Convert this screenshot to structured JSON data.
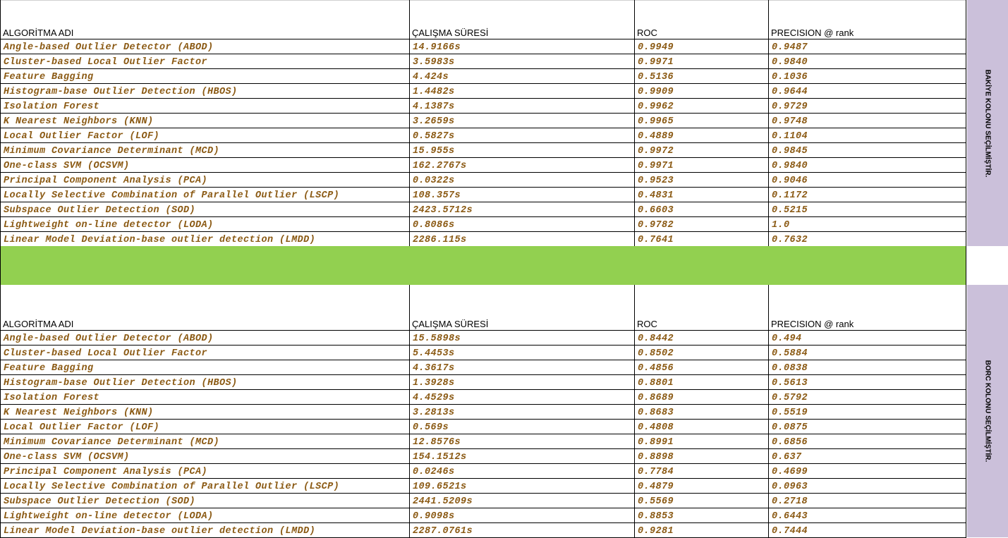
{
  "headers": {
    "algorithm": "ALGORİTMA ADI",
    "runtime": "ÇALIŞMA SÜRESİ",
    "roc": "ROC",
    "precision": "PRECISION @ rank"
  },
  "colors": {
    "data_text": "#8b5a14",
    "separator": "#92d050",
    "side_label_bg": "#cbc0da"
  },
  "sections": [
    {
      "side_label": "BAKİYE KOLONU SEÇİLMİŞTİR.",
      "rows": [
        {
          "name": "Angle-based Outlier Detector (ABOD)",
          "time": "14.9166s",
          "roc": "0.9949",
          "precision": "0.9487"
        },
        {
          "name": "Cluster-based Local Outlier Factor",
          "time": "3.5983s",
          "roc": "0.9971",
          "precision": "0.9840"
        },
        {
          "name": "Feature Bagging",
          "time": "4.424s",
          "roc": "0.5136",
          "precision": "0.1036"
        },
        {
          "name": "Histogram-base Outlier Detection (HBOS)",
          "time": "1.4482s",
          "roc": "0.9909",
          "precision": "0.9644"
        },
        {
          "name": "Isolation Forest",
          "time": "4.1387s",
          "roc": "0.9962",
          "precision": "0.9729"
        },
        {
          "name": "K Nearest Neighbors (KNN)",
          "time": "3.2659s",
          "roc": "0.9965",
          "precision": "0.9748"
        },
        {
          "name": "Local Outlier Factor (LOF)",
          "time": "0.5827s",
          "roc": "0.4889",
          "precision": "0.1104"
        },
        {
          "name": "Minimum Covariance Determinant (MCD)",
          "time": "15.955s",
          "roc": "0.9972",
          "precision": "0.9845"
        },
        {
          "name": "One-class SVM (OCSVM)",
          "time": "162.2767s",
          "roc": "0.9971",
          "precision": "0.9840"
        },
        {
          "name": "Principal Component Analysis (PCA)",
          "time": "0.0322s",
          "roc": "0.9523",
          "precision": "0.9046"
        },
        {
          "name": "Locally Selective Combination of Parallel Outlier (LSCP)",
          "time": "108.357s",
          "roc": "0.4831",
          "precision": "0.1172"
        },
        {
          "name": "Subspace Outlier Detection (SOD)",
          "time": "2423.5712s",
          "roc": "0.6603",
          "precision": "0.5215"
        },
        {
          "name": "Lightweight on-line detector (LODA)",
          "time": "0.8086s",
          "roc": "0.9782",
          "precision": "1.0"
        },
        {
          "name": "Linear Model Deviation-base outlier detection (LMDD)",
          "time": "2286.115s",
          "roc": "0.7641",
          "precision": "0.7632"
        }
      ]
    },
    {
      "side_label": "BORC KOLONU SEÇİLMİŞTİR.",
      "rows": [
        {
          "name": "Angle-based Outlier Detector (ABOD)",
          "time": "15.5898s",
          "roc": "0.8442",
          "precision": "0.494"
        },
        {
          "name": "Cluster-based Local Outlier Factor",
          "time": "5.4453s",
          "roc": "0.8502",
          "precision": "0.5884"
        },
        {
          "name": "Feature Bagging",
          "time": "4.3617s",
          "roc": "0.4856",
          "precision": "0.0838"
        },
        {
          "name": "Histogram-base Outlier Detection (HBOS)",
          "time": "1.3928s",
          "roc": "0.8801",
          "precision": "0.5613"
        },
        {
          "name": "Isolation Forest",
          "time": "4.4529s",
          "roc": "0.8689",
          "precision": "0.5792"
        },
        {
          "name": "K Nearest Neighbors (KNN)",
          "time": "3.2813s",
          "roc": "0.8683",
          "precision": "0.5519"
        },
        {
          "name": "Local Outlier Factor (LOF)",
          "time": "0.569s",
          "roc": "0.4808",
          "precision": "0.0875"
        },
        {
          "name": "Minimum Covariance Determinant (MCD)",
          "time": "12.8576s",
          "roc": "0.8991",
          "precision": "0.6856"
        },
        {
          "name": "One-class SVM (OCSVM)",
          "time": "154.1512s",
          "roc": "0.8898",
          "precision": "0.637"
        },
        {
          "name": "Principal Component Analysis (PCA)",
          "time": "0.0246s",
          "roc": "0.7784",
          "precision": "0.4699"
        },
        {
          "name": "Locally Selective Combination of Parallel Outlier (LSCP)",
          "time": "109.6521s",
          "roc": "0.4879",
          "precision": "0.0963"
        },
        {
          "name": "Subspace Outlier Detection (SOD)",
          "time": "2441.5209s",
          "roc": "0.5569",
          "precision": "0.2718"
        },
        {
          "name": "Lightweight on-line detector (LODA)",
          "time": "0.9098s",
          "roc": "0.8853",
          "precision": "0.6443"
        },
        {
          "name": "Linear Model Deviation-base outlier detection (LMDD)",
          "time": "2287.0761s",
          "roc": "0.9281",
          "precision": "0.7444"
        }
      ]
    }
  ]
}
